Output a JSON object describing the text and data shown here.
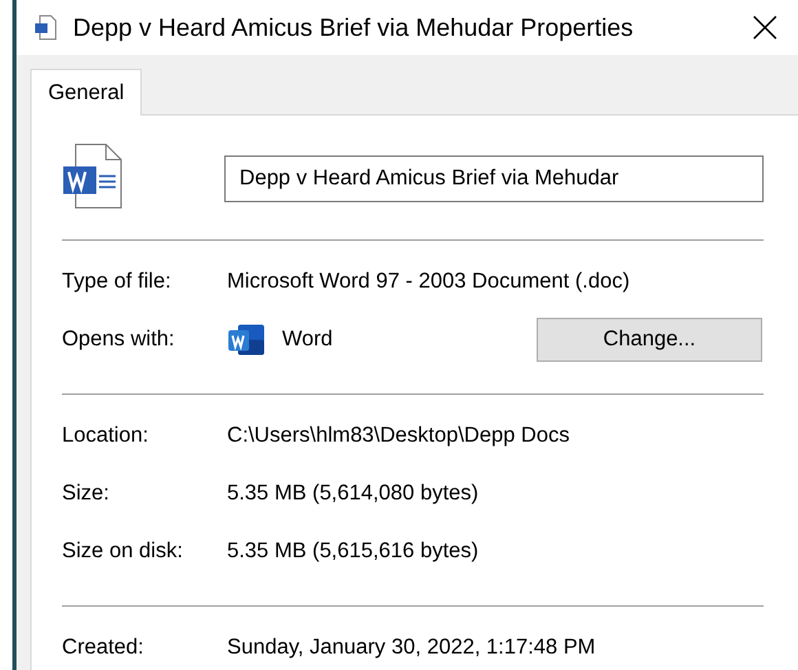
{
  "window": {
    "title": "Depp v Heard Amicus Brief via Mehudar Properties"
  },
  "tabs": [
    {
      "label": "General",
      "selected": true
    }
  ],
  "file_name": {
    "value": "Depp v Heard Amicus Brief via Mehudar"
  },
  "sections": [
    {
      "rows": [
        {
          "kind": "text",
          "label": "Type of file:",
          "value": "Microsoft Word 97 - 2003 Document (.doc)"
        },
        {
          "kind": "opens_with",
          "label": "Opens with:",
          "value": "Word",
          "button": "Change..."
        }
      ]
    },
    {
      "rows": [
        {
          "kind": "text",
          "label": "Location:",
          "value": "C:\\Users\\hlm83\\Desktop\\Depp Docs"
        },
        {
          "kind": "text",
          "label": "Size:",
          "value": "5.35 MB (5,614,080 bytes)"
        },
        {
          "kind": "text",
          "label": "Size on disk:",
          "value": "5.35 MB (5,615,616 bytes)"
        }
      ]
    },
    {
      "rows": [
        {
          "kind": "text",
          "label": "Created:",
          "value": "Sunday, January 30, 2022, 1:17:48 PM"
        }
      ]
    }
  ]
}
